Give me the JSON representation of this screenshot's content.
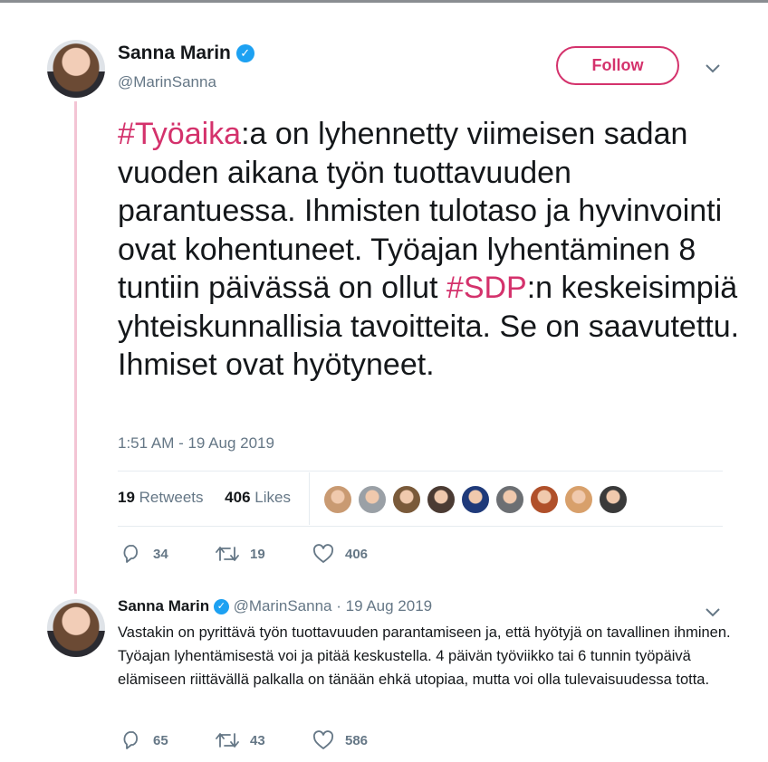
{
  "tweet": {
    "author_name": "Sanna Marin",
    "handle": "@MarinSanna",
    "follow_label": "Follow",
    "text_parts": [
      {
        "text": "#Työaika",
        "type": "hashtag"
      },
      {
        "text": ":a on lyhennetty viimeisen sadan vuoden aikana työn tuottavuuden parantuessa. Ihmisten tulotaso ja hyvinvointi ovat kohentuneet. Työajan lyhentäminen 8 tuntiin päivässä on ollut ",
        "type": "text"
      },
      {
        "text": "#SDP",
        "type": "hashtag"
      },
      {
        "text": ":n keskeisimpiä yhteiskunnallisia tavoitteita. Se on saavutettu. Ihmiset ovat hyötyneet.",
        "type": "text"
      }
    ],
    "timestamp": "1:51 AM - 19 Aug 2019",
    "retweets_count": "19",
    "retweets_label": "Retweets",
    "likes_count": "406",
    "likes_label": "Likes",
    "actions": {
      "replies": "34",
      "retweets": "19",
      "likes": "406"
    },
    "likers": [
      {
        "name": "liker-1",
        "color": "#c99a72"
      },
      {
        "name": "liker-2",
        "color": "#9aa0a6"
      },
      {
        "name": "liker-3",
        "color": "#7a5a3a"
      },
      {
        "name": "liker-4",
        "color": "#4b3b33"
      },
      {
        "name": "liker-5",
        "color": "#1f3a7a"
      },
      {
        "name": "liker-6",
        "color": "#6c6f73"
      },
      {
        "name": "liker-7",
        "color": "#b0502a"
      },
      {
        "name": "liker-8",
        "color": "#d8a06b"
      },
      {
        "name": "liker-9",
        "color": "#3a3a3a"
      }
    ]
  },
  "reply": {
    "author_name": "Sanna Marin",
    "handle": "@MarinSanna",
    "separator": "·",
    "date": "19 Aug 2019",
    "text": "Vastakin on pyrittävä työn tuottavuuden parantamiseen ja, että hyötyjä on tavallinen ihminen. Työajan lyhentämisestä voi ja pitää keskustella. 4 päivän työviikko tai 6 tunnin työpäivä elämiseen riittävällä palkalla on tänään ehkä utopiaa, mutta voi olla tulevaisuudessa totta.",
    "actions": {
      "replies": "65",
      "retweets": "43",
      "likes": "586"
    }
  },
  "colors": {
    "accent": "#d4326c",
    "verified": "#1da1f2",
    "muted": "#657786"
  },
  "icons": [
    "verified-badge-icon",
    "chevron-down-icon",
    "reply-icon",
    "retweet-icon",
    "like-icon"
  ]
}
